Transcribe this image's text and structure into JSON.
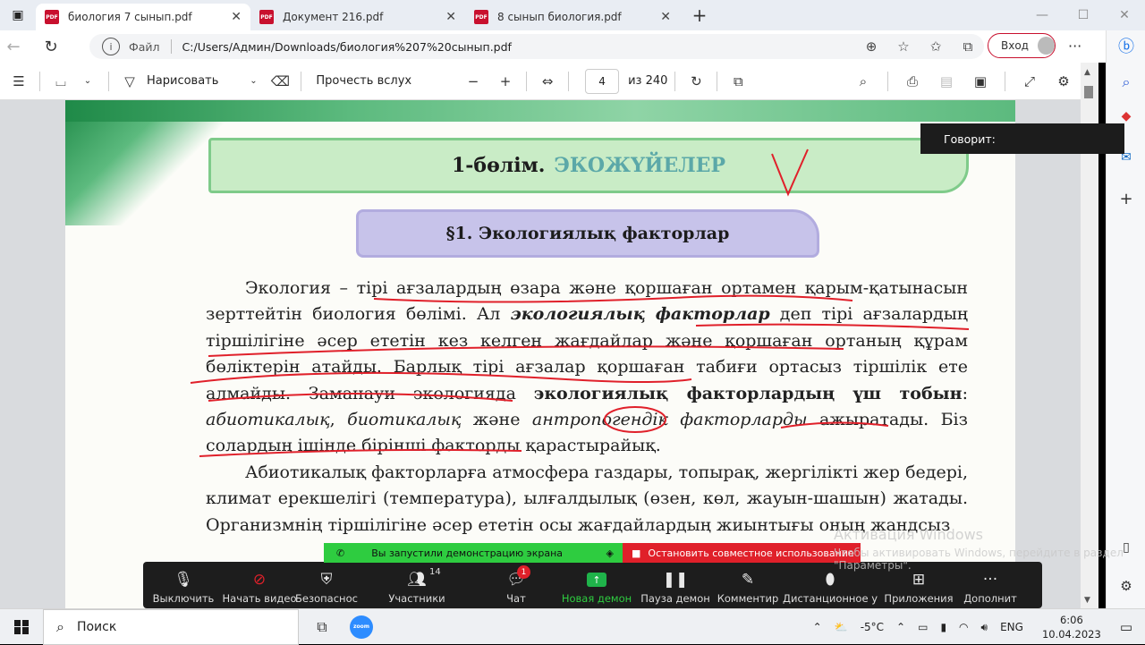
{
  "tabs": [
    {
      "label": "биология 7 сынып.pdf",
      "close": "✕",
      "active": true
    },
    {
      "label": "Документ 216.pdf",
      "close": "✕",
      "active": false
    },
    {
      "label": "8 сынып биология.pdf",
      "close": "✕",
      "active": false
    }
  ],
  "pdf_badge": "PDF",
  "new_tab": "+",
  "address": {
    "file_label": "Файл",
    "url": "C:/Users/Админ/Downloads/биология%207%20сынып.pdf"
  },
  "login_label": "Вход",
  "toolbar": {
    "draw_label": "Нарисовать",
    "read_aloud_label": "Прочесть вслух",
    "page_number": "4",
    "page_total": "из 240"
  },
  "tooltip": "Говорит:",
  "document": {
    "section_prefix": "1-бөлім.",
    "section_title": "ЭКОЖҮЙЕЛЕР",
    "paragraph_title": "§1. Экологиялық факторлар",
    "p1_a": "Экология – ",
    "p1_b": "тірі ағзалардың өзара және қоршаған ортамен қарым-қатынасын зерттейтін биология бөлімі. Ал ",
    "p1_c": "экологиялық факторлар",
    "p1_d": " деп тірі ағзалардың тіршілігіне әсер ететін кез келген жағдайлар және қоршаған ортаның құрам бөліктерін атайды. Барлық тірі ағзалар қоршаған табиғи ортасыз тіршілік ете алмайды. Заманауи экологияда ",
    "p1_e": "экологиялық факторлардың үш тобын",
    "p1_f": ": ",
    "p1_g": "абиотикалық",
    "p1_h": ", ",
    "p1_i": "биотикалық",
    "p1_j": " және ",
    "p1_k": "антропогендік факторларды",
    "p1_l": " ажыратады. Біз солардың ішінде бірінші факторды қарастырайық.",
    "p2": "Абиотикалық факторларға атмосфера газдары, топырақ, жергілікті жер бедері, климат ерекшелігі (температура), ылғалдылық (өзен, көл, жауын-шашын) жатады. Организмнің тіршілігіне әсер ететін осы жағдайлардың жиынтығы оның жандсыз"
  },
  "share_bar": {
    "sharing_text": "Вы запустили демонстрацию экрана",
    "stop_text": "Остановить совместное использование"
  },
  "zoom": {
    "mute": "Выключить",
    "video": "Начать видео",
    "security": "Безопаснос",
    "participants": "Участники",
    "participants_count": "14",
    "chat": "Чат",
    "chat_badge": "1",
    "new_share": "Новая демон",
    "pause_share": "Пауза демон",
    "annotate": "Комментир",
    "remote": "Дистанционное у",
    "apps": "Приложения",
    "more": "Дополнит"
  },
  "watermark": {
    "line1": "Активация Windows",
    "line2": "Чтобы активировать Windows, перейдите в раздел \"Параметры\"."
  },
  "taskbar": {
    "search_label": "Поиск",
    "zoom_app": "zoom",
    "temperature": "-5°C",
    "language": "ENG",
    "time": "6:06",
    "date": "10.04.2023"
  },
  "colors": {
    "accent_red": "#c8102e",
    "zoom_green": "#2ecc40",
    "zoom_red": "#e0202a",
    "section_teal": "#5ba8a8"
  }
}
